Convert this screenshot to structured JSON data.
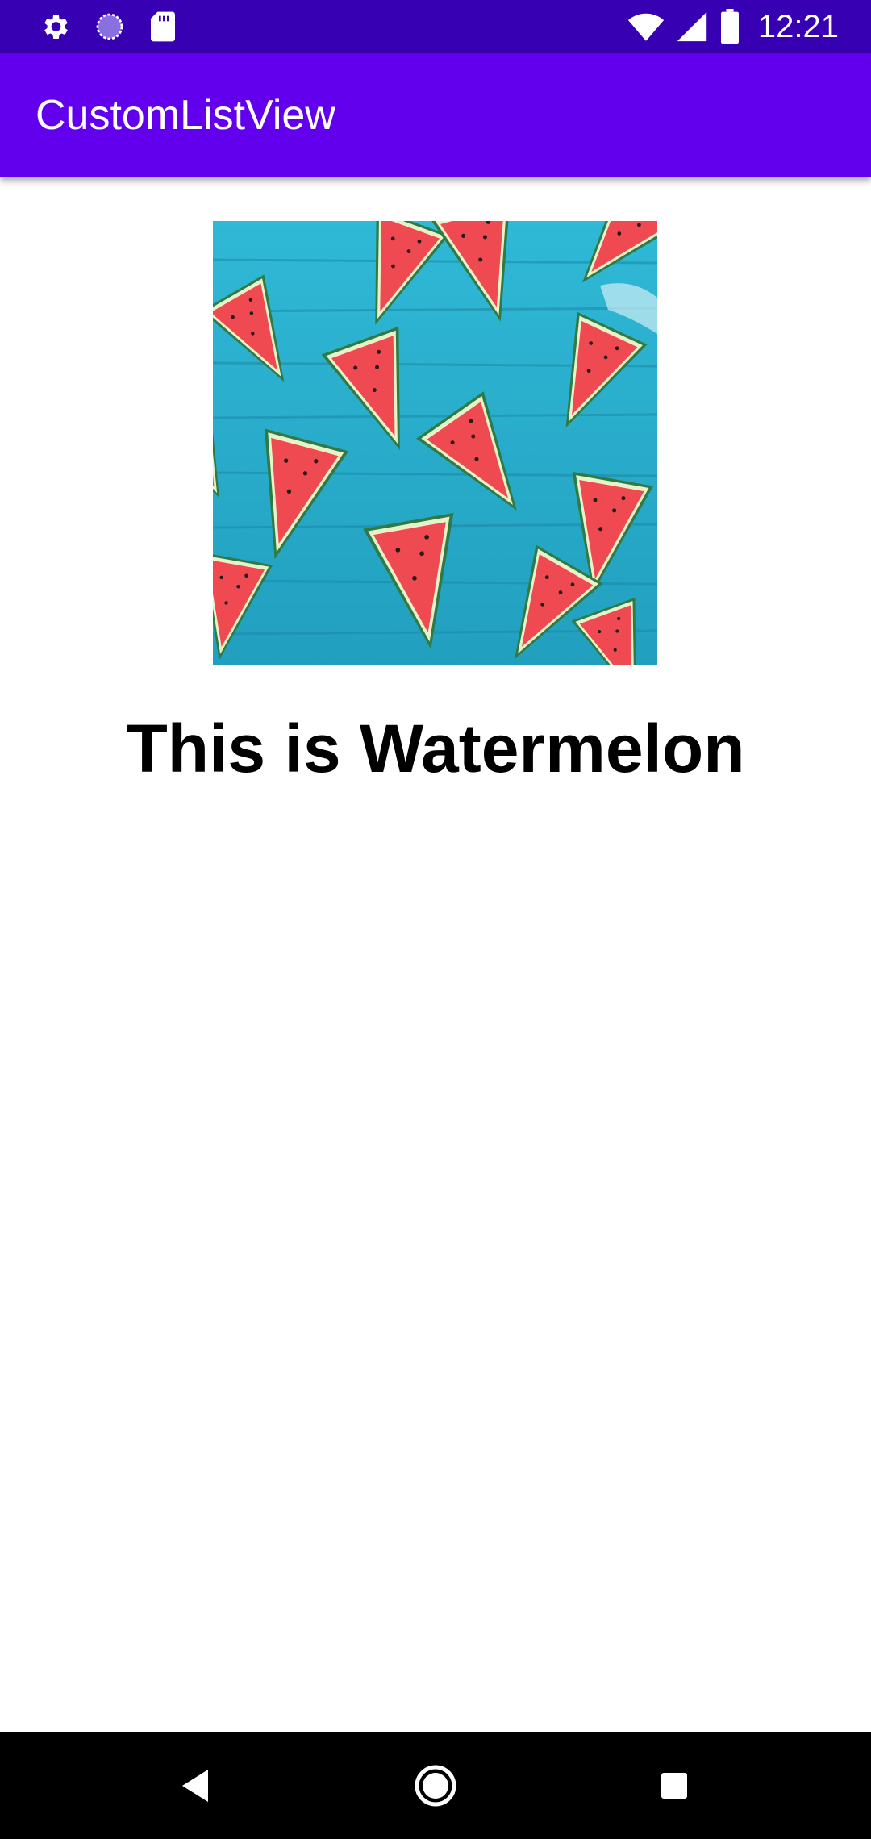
{
  "status_bar": {
    "time": "12:21",
    "icons_left": [
      "settings-icon",
      "sync-icon",
      "sd-card-icon"
    ],
    "icons_right": [
      "wifi-icon",
      "cell-signal-icon",
      "battery-icon"
    ]
  },
  "app_bar": {
    "title": "CustomListView"
  },
  "detail": {
    "image_subject": "watermelon slices on blue wooden table",
    "caption": "This is Watermelon"
  },
  "nav_bar": {
    "buttons": [
      "back-icon",
      "home-icon",
      "recents-icon"
    ]
  },
  "colors": {
    "status_bar": "#3700b3",
    "app_bar": "#6200ee",
    "background": "#ffffff",
    "nav_bar": "#000000",
    "table_blue": "#2bb3cf",
    "melon_red": "#ef4a52",
    "rind_green": "#2f7a45"
  }
}
